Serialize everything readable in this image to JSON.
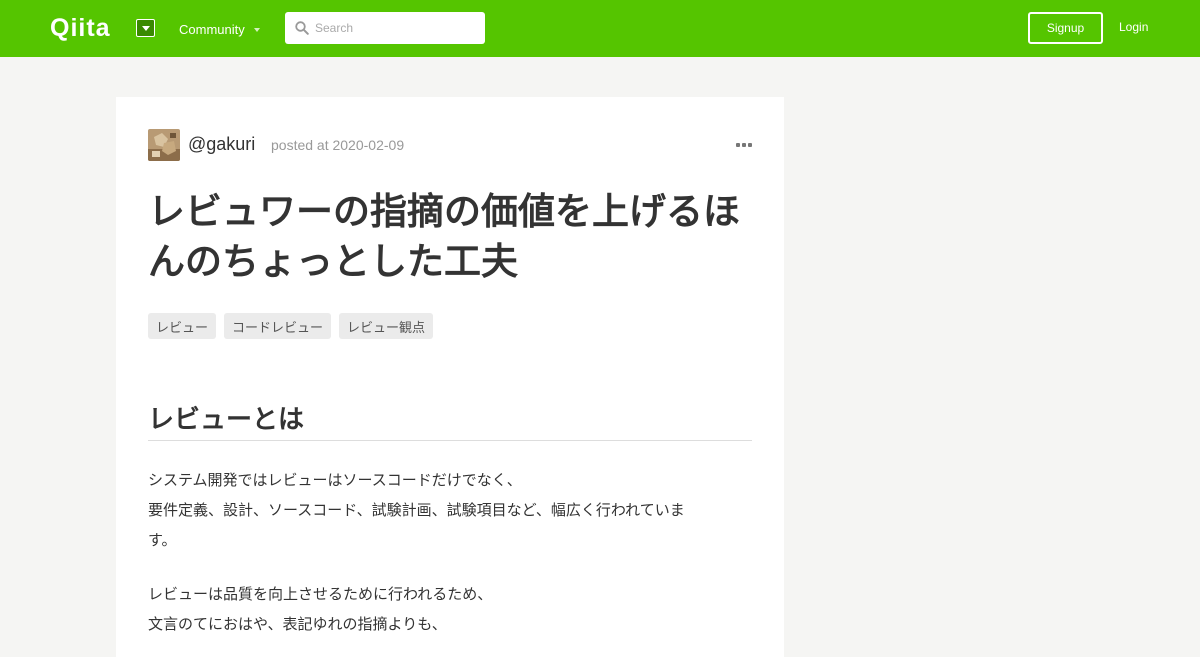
{
  "header": {
    "logo": "Qiita",
    "community_label": "Community",
    "search_placeholder": "Search",
    "signup_label": "Signup",
    "login_label": "Login",
    "brand_color": "#55c500"
  },
  "article": {
    "author": "@gakuri",
    "posted": "posted at 2020-02-09",
    "title": "レビュワーの指摘の価値を上げるほんのちょっとした工夫",
    "tags": [
      "レビュー",
      "コードレビュー",
      "レビュー観点"
    ],
    "section_heading": "レビューとは",
    "paragraph1_lines": [
      "システム開発ではレビューはソースコードだけでなく、",
      "要件定義、設計、ソースコード、試験計画、試験項目など、幅広く行われていま",
      "す。"
    ],
    "paragraph2_lines": [
      "レビューは品質を向上させるために行われるため、",
      "文言のてにおはや、表記ゆれの指摘よりも、"
    ]
  }
}
